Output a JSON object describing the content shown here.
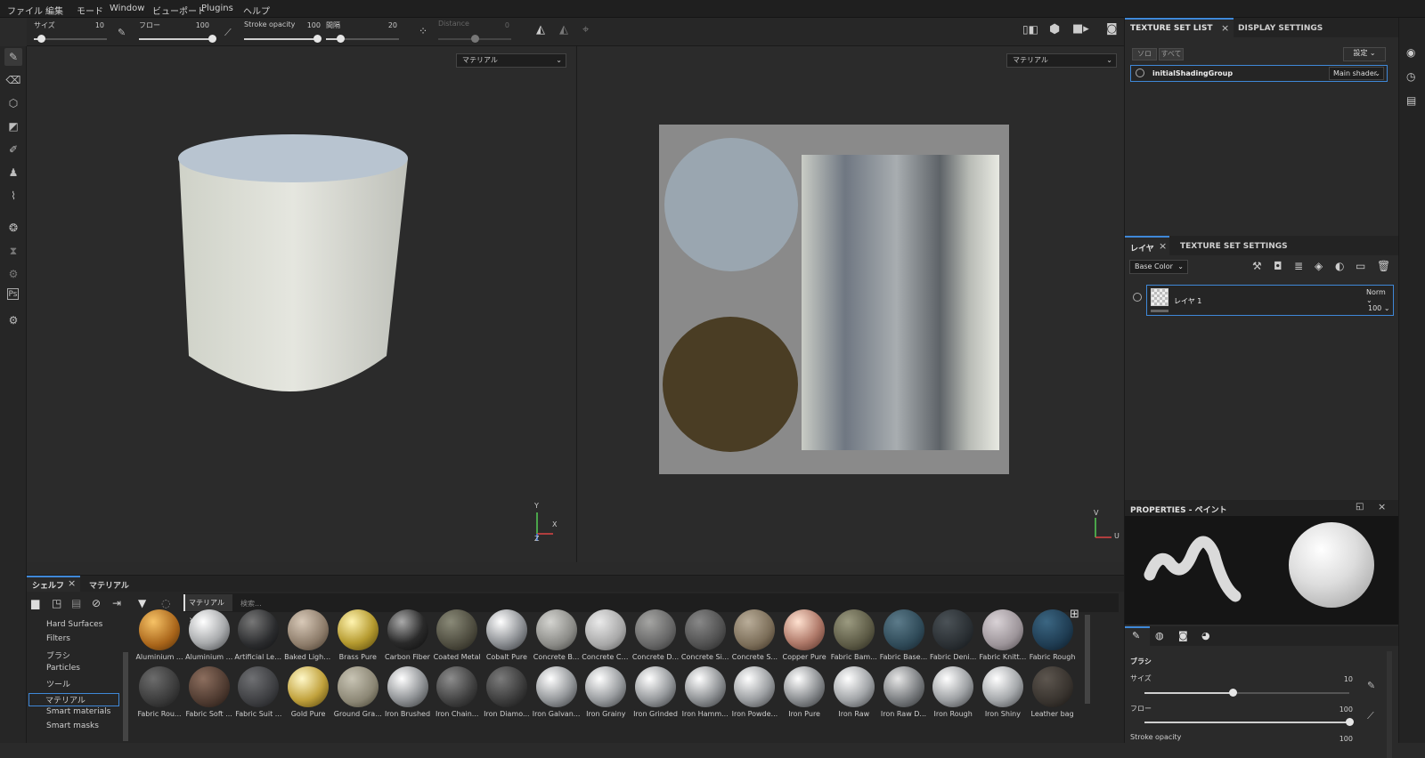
{
  "menubar": {
    "items": [
      "ファイル",
      "編集",
      "モード",
      "Window",
      "ビューポート",
      "Plugins",
      "ヘルプ"
    ]
  },
  "toolbar": {
    "size_label": "サイズ",
    "size_value": "10",
    "size_fraction": 0.1,
    "flow_label": "フロー",
    "flow_value": "100",
    "flow_fraction": 1.0,
    "stroke_label": "Stroke opacity",
    "stroke_value": "100",
    "stroke_fraction": 1.0,
    "spacing_label": "間隔",
    "spacing_value": "20",
    "spacing_fraction": 0.2,
    "distance_label": "Distance",
    "distance_value": "0"
  },
  "viewport3d": {
    "mode_select": "マテリアル",
    "axes": {
      "y": "Y",
      "x": "X",
      "z": "Z"
    }
  },
  "viewport2d": {
    "mode_select": "マテリアル",
    "axes": {
      "v": "V",
      "u": "U"
    }
  },
  "texture_set_list": {
    "tab": "TEXTURE SET LIST",
    "tab2": "DISPLAY SETTINGS",
    "solo_btn": "ソロ",
    "all_btn": "すべて",
    "settings_btn": "設定",
    "item_name": "initialShadingGroup",
    "shader": "Main shader"
  },
  "layers": {
    "tab": "レイヤ",
    "tab2": "TEXTURE SET SETTINGS",
    "channel_select": "Base Color",
    "layer_name": "レイヤ 1",
    "blend": "Norm",
    "opacity": "100"
  },
  "properties": {
    "title": "PROPERTIES - ペイント",
    "brush_section": "ブラシ",
    "size_label": "サイズ",
    "size_value": "10",
    "size_fraction": 0.43,
    "flow_label": "フロー",
    "flow_value": "100",
    "flow_fraction": 1.0,
    "stroke_label": "Stroke opacity",
    "stroke_value": "100"
  },
  "shelf": {
    "tab": "シェルフ",
    "tab2": "マテリアル",
    "filter_tag": "マテリアル",
    "search_placeholder": "検索...",
    "categories": [
      "Hard Surfaces",
      "Filters",
      "ブラシ",
      "Particles",
      "ツール",
      "マテリアル",
      "Smart materials",
      "Smart masks"
    ],
    "selected_category": "マテリアル",
    "materials_row1": [
      "Aluminium ...",
      "Aluminium ...",
      "Artificial Lea...",
      "Baked Light...",
      "Brass Pure",
      "Carbon Fiber",
      "Coated Metal",
      "Cobalt Pure",
      "Concrete B...",
      "Concrete Cl...",
      "Concrete D...",
      "Concrete Si...",
      "Concrete S...",
      "Copper Pure",
      "Fabric Bam...",
      "Fabric Base...",
      "Fabric Deni...",
      "Fabric Knitt...",
      "Fabric Rough"
    ],
    "materials_row2": [
      "Fabric Rou...",
      "Fabric Soft ...",
      "Fabric Suit ...",
      "Gold Pure",
      "Ground Gra...",
      "Iron Brushed",
      "Iron Chain...",
      "Iron Diamo...",
      "Iron Galvan...",
      "Iron Grainy",
      "Iron Grinded",
      "Iron Hamm...",
      "Iron Powde...",
      "Iron Pure",
      "Iron Raw",
      "Iron Raw D...",
      "Iron Rough",
      "Iron Shiny",
      "Leather bag"
    ]
  },
  "colors": {
    "accent": "#3f88d8",
    "bg": "#2a2a2a"
  }
}
